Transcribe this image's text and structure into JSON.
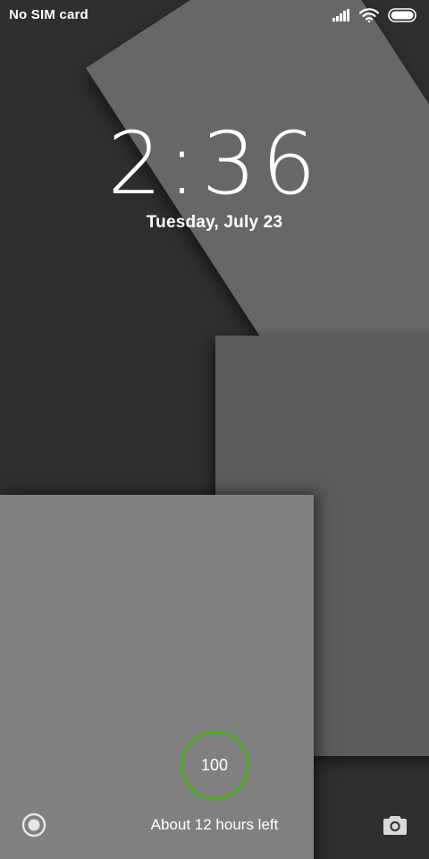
{
  "status_bar": {
    "carrier": "No SIM card",
    "signal_icon": "cellular-signal-bars",
    "wifi_icon": "wifi",
    "battery_icon": "battery-full"
  },
  "clock": {
    "time": "2:36",
    "date": "Tuesday, July 23"
  },
  "battery": {
    "level": "100",
    "level_fraction": 1.0,
    "ring_color": "#4caf1f",
    "estimate": "About 12 hours left"
  },
  "shortcuts": {
    "left_icon": "control-center-circle",
    "right_icon": "camera"
  },
  "colors": {
    "bg_dark": "#2f2f2f",
    "tile_light": "#808080",
    "tile_mid": "#5b5b5b",
    "tile_rotated": "#676767",
    "text": "#ffffff"
  }
}
